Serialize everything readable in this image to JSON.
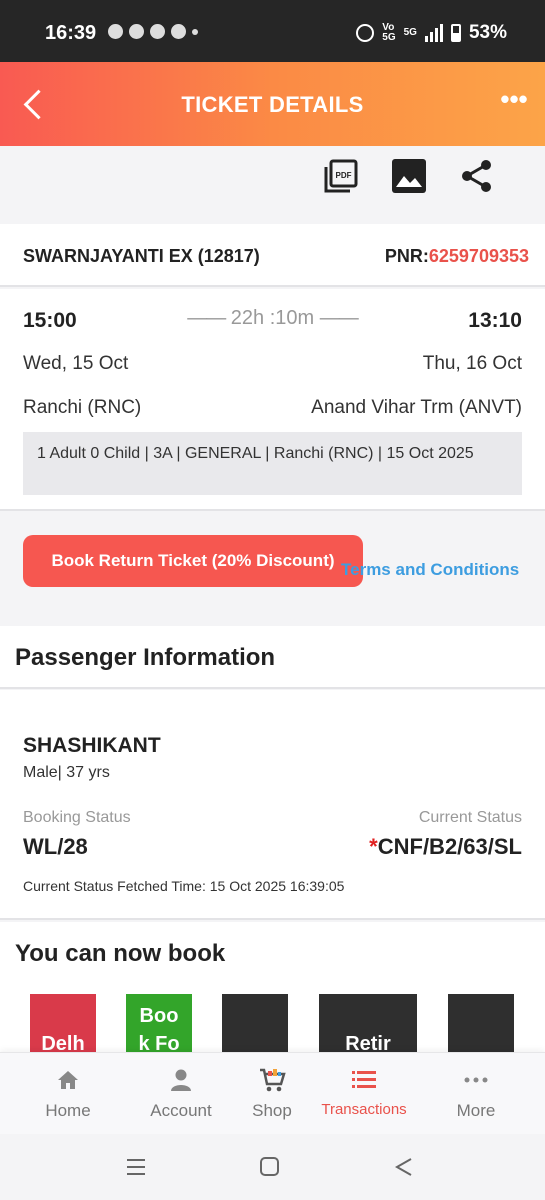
{
  "status_bar": {
    "time": "16:39",
    "network": "5G",
    "volte": "Vo\n5G",
    "battery": "53%"
  },
  "header": {
    "title": "TICKET DETAILS",
    "more": "•••"
  },
  "train": {
    "name": "SWARNJAYANTI EX  (12817)",
    "pnr_label": "PNR:",
    "pnr": "6259709353"
  },
  "journey": {
    "departure_time": "15:00",
    "arrival_time": "13:10",
    "duration": "22h :10m",
    "departure_date": "Wed, 15 Oct",
    "arrival_date": "Thu, 16 Oct",
    "from_station": "Ranchi (RNC)",
    "to_station": "Anand Vihar Trm (ANVT)",
    "summary": "1 Adult 0 Child  | 3A | GENERAL | Ranchi (RNC) | 15 Oct 2025"
  },
  "return_booking": {
    "button_label": "Book Return Ticket (20% Discount)",
    "terms_label": "Terms and Conditions"
  },
  "passenger_info": {
    "title": "Passenger Information",
    "name": "SHASHIKANT",
    "meta": "Male| 37 yrs",
    "booking_status_label": "Booking Status",
    "booking_status": "WL/28",
    "current_status_label": "Current Status",
    "current_status_mark": "*",
    "current_status": "CNF/B2/63/SL",
    "fetched_time": "Current Status Fetched Time: 15 Oct 2025 16:39:05"
  },
  "book_now": {
    "title": "You can now book",
    "tiles": [
      {
        "label": "Delh",
        "color": "#d93a4a"
      },
      {
        "label": "Boo\nk Fo",
        "color": "#33a52a"
      },
      {
        "label": "",
        "color": "#2f2f2f"
      },
      {
        "label": "Retir",
        "color": "#2f2f2f"
      },
      {
        "label": "",
        "color": "#2f2f2f"
      }
    ]
  },
  "bottom_nav": {
    "items": [
      {
        "label": "Home",
        "icon": "home-icon"
      },
      {
        "label": "Account",
        "icon": "account-icon"
      },
      {
        "label": "Shop",
        "icon": "cart-icon"
      },
      {
        "label": "Transactions",
        "icon": "list-icon",
        "active": true
      },
      {
        "label": "More",
        "icon": "more-dots-icon"
      }
    ]
  },
  "colors": {
    "accent": "#e9524b",
    "link": "#3d9de0",
    "header_start": "#f95a52",
    "header_end": "#fca448"
  }
}
